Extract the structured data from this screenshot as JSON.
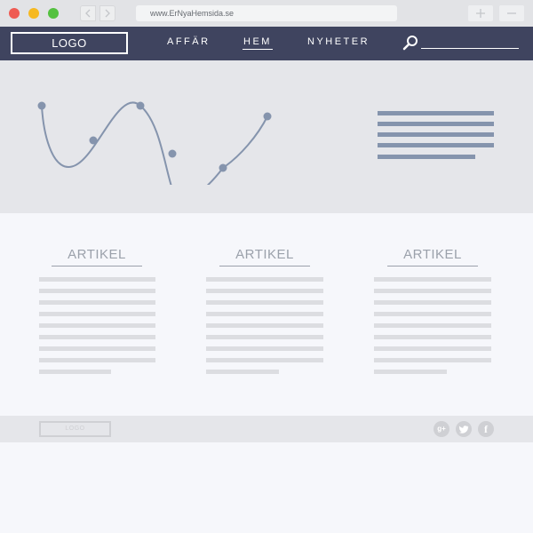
{
  "browser": {
    "url": "www.ErNyaHemsida.se"
  },
  "header": {
    "logo": "LOGO",
    "nav": [
      {
        "label": "AFFÄR"
      },
      {
        "label": "HEM"
      },
      {
        "label": "NYHETER"
      }
    ]
  },
  "articles": [
    {
      "title": "ARTIKEL"
    },
    {
      "title": "ARTIKEL"
    },
    {
      "title": "ARTIKEL"
    }
  ],
  "footer": {
    "logo": "LOGO",
    "social": [
      "google-plus-icon",
      "twitter-icon",
      "facebook-icon"
    ]
  },
  "colors": {
    "header_bg": "#3f445f",
    "hero_bg": "#e5e6ea",
    "accent": "#8594ad"
  }
}
